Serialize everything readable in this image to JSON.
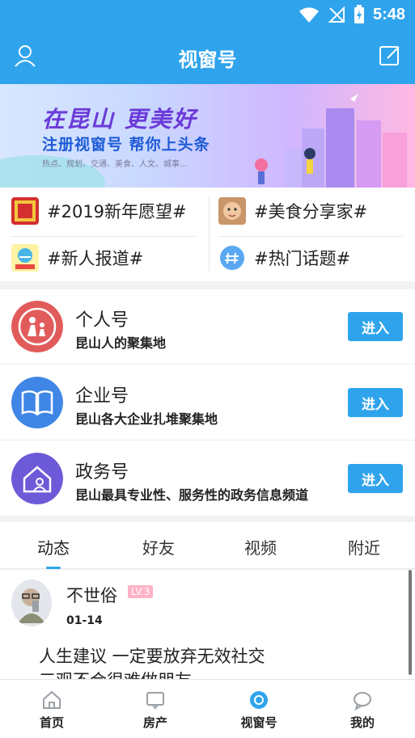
{
  "status": {
    "time": "5:48",
    "icons": [
      "wifi-icon",
      "signal-off-icon",
      "battery-charging-icon"
    ]
  },
  "title": "视窗号",
  "banner": {
    "brand": "在昆山 更美好",
    "headline": "注册视窗号 帮你上头条",
    "tags": "热点、规划、交通、美食、人文、城事..."
  },
  "topics": [
    {
      "label": "#2019新年愿望#",
      "icon": "new-year-badge-icon"
    },
    {
      "label": "#美食分享家#",
      "icon": "child-photo-icon"
    },
    {
      "label": "#新人报道#",
      "icon": "newcomer-badge-icon"
    },
    {
      "label": "#热门话题#",
      "icon": "hash-bubble-icon"
    }
  ],
  "accounts": [
    {
      "name": "个人号",
      "desc": "昆山人的聚集地",
      "button": "进入",
      "color": "#e25b5b"
    },
    {
      "name": "企业号",
      "desc": "昆山各大企业扎堆聚集地",
      "button": "进入",
      "color": "#3f86e6"
    },
    {
      "name": "政务号",
      "desc": "昆山最具专业性、服务性的政务信息频道",
      "button": "进入",
      "color": "#6c5ad8"
    }
  ],
  "tabs": [
    "动态",
    "好友",
    "视频",
    "附近"
  ],
  "feed": {
    "user": "不世俗",
    "level": "LV.3",
    "date": "01-14",
    "line1": "人生建议 一定要放弃无效社交",
    "line2": "三观不合很难做朋友"
  },
  "nav": [
    "首页",
    "房产",
    "视窗号",
    "我的"
  ],
  "colors": {
    "primary": "#2fa4ec"
  }
}
